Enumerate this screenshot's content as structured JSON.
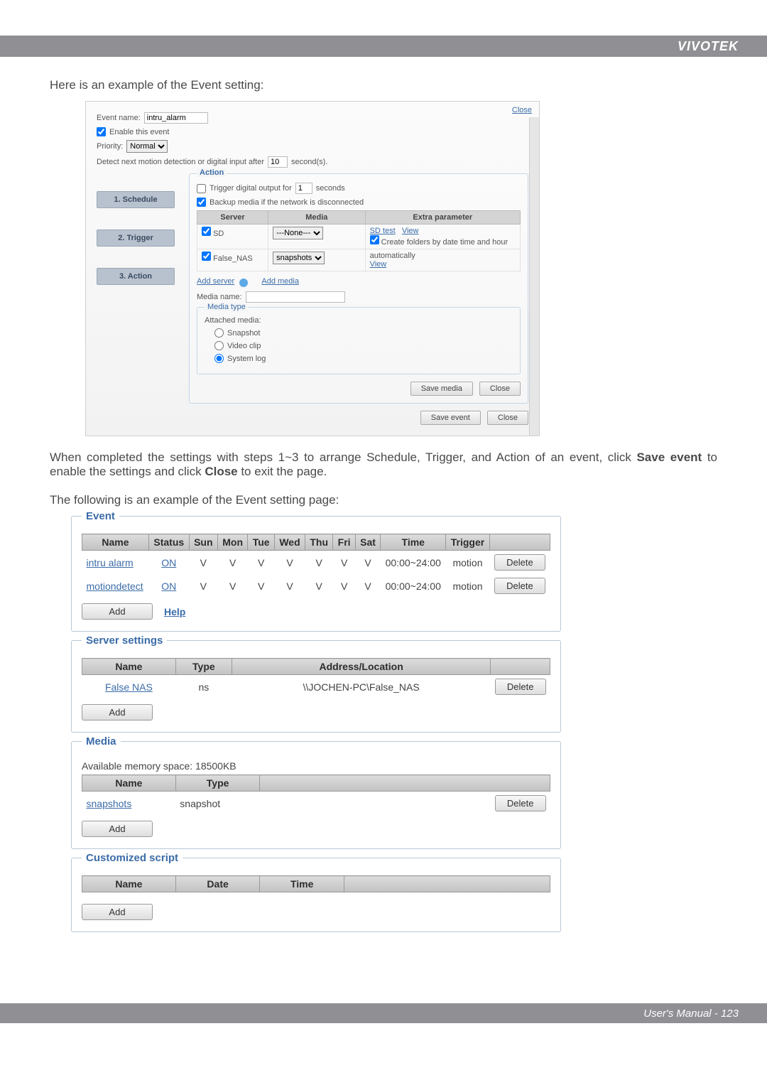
{
  "brand": "VIVOTEK",
  "intro1": "Here is an example of the Event setting:",
  "panel1": {
    "close": "Close",
    "eventNameLabel": "Event name:",
    "eventNameValue": "intru_alarm",
    "enableLabel": "Enable this event",
    "priorityLabel": "Priority:",
    "priorityValue": "Normal",
    "detectLabel": "Detect next motion detection or digital input after",
    "detectValue": "10",
    "detectUnit": "second(s).",
    "step1": "1. Schedule",
    "step2": "2. Trigger",
    "step3": "3. Action",
    "actionLegend": "Action",
    "triggerOutLabel": "Trigger digital output for",
    "triggerOutValue": "1",
    "triggerOutUnit": "seconds",
    "backupLabel": "Backup media if the network is disconnected",
    "th_server": "Server",
    "th_media": "Media",
    "th_extra": "Extra parameter",
    "row1_server": "SD",
    "row1_media": "---None---",
    "row1_sdtest": "SD test",
    "row1_view": "View",
    "row1_extra": "Create folders by date time and hour",
    "row2_server": "False_NAS",
    "row2_media": "snapshots",
    "row2_auto": "automatically",
    "row2_view": "View",
    "addServer": "Add server",
    "addMedia": "Add media",
    "mediaNameLabel": "Media name:",
    "mediaTypeLegend": "Media type",
    "attached": "Attached media:",
    "snapshot": "Snapshot",
    "videoclip": "Video clip",
    "systemlog": "System log",
    "saveMedia": "Save media",
    "closeBtn": "Close",
    "saveEvent": "Save event",
    "closeEvent": "Close"
  },
  "body1a": "When completed the settings with steps 1~3 to arrange Schedule, Trigger, and Action of an event, click ",
  "body1b": "Save event",
  "body1c": " to enable the settings and click ",
  "body1d": "Close",
  "body1e": " to exit the page.",
  "intro2": "The following is an example of the Event setting page:",
  "events": {
    "title": "Event",
    "headers": [
      "Name",
      "Status",
      "Sun",
      "Mon",
      "Tue",
      "Wed",
      "Thu",
      "Fri",
      "Sat",
      "Time",
      "Trigger",
      ""
    ],
    "rows": [
      {
        "name": "intru  alarm",
        "status": "ON",
        "days": [
          "V",
          "V",
          "V",
          "V",
          "V",
          "V",
          "V"
        ],
        "time": "00:00~24:00",
        "trigger": "motion",
        "btn": "Delete"
      },
      {
        "name": "motiondetect",
        "status": "ON",
        "days": [
          "V",
          "V",
          "V",
          "V",
          "V",
          "V",
          "V"
        ],
        "time": "00:00~24:00",
        "trigger": "motion",
        "btn": "Delete"
      }
    ],
    "add": "Add",
    "help": "Help"
  },
  "servers": {
    "title": "Server settings",
    "headers": [
      "Name",
      "Type",
      "Address/Location",
      ""
    ],
    "rows": [
      {
        "name": "False  NAS",
        "type": "ns",
        "addr": "\\\\JOCHEN-PC\\False_NAS",
        "btn": "Delete"
      }
    ],
    "add": "Add"
  },
  "media": {
    "title": "Media",
    "memory": "Available memory space: 18500KB",
    "headers": [
      "Name",
      "Type",
      ""
    ],
    "rows": [
      {
        "name": "snapshots",
        "type": "snapshot",
        "btn": "Delete"
      }
    ],
    "add": "Add"
  },
  "script": {
    "title": "Customized script",
    "headers": [
      "Name",
      "Date",
      "Time"
    ],
    "add": "Add"
  },
  "footer": "User's Manual - 123"
}
